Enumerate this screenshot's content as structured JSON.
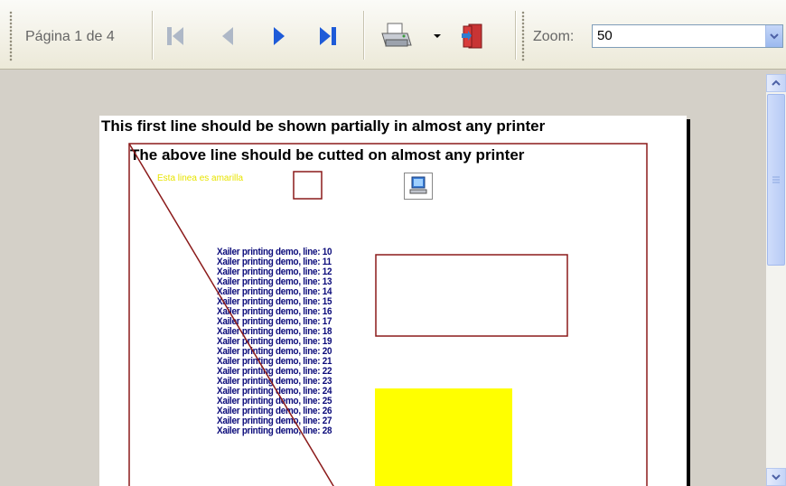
{
  "toolbar": {
    "page_label": "Página 1 de 4",
    "zoom_label": "Zoom:",
    "zoom_value": "50",
    "buttons": [
      "first-page",
      "previous-page",
      "next-page",
      "last-page",
      "print",
      "print-options",
      "exit"
    ]
  },
  "document": {
    "line1": "This first line should be shown partially in almost any printer",
    "line2": "The above line should be cutted on almost any printer",
    "yellow_text": "Esta linea es amarilla",
    "demo_lines": [
      "Xailer printing demo, line: 10",
      "Xailer printing demo, line: 11",
      "Xailer printing demo, line: 12",
      "Xailer printing demo, line: 13",
      "Xailer printing demo, line: 14",
      "Xailer printing demo, line: 15",
      "Xailer printing demo, line: 16",
      "Xailer printing demo, line: 17",
      "Xailer printing demo, line: 18",
      "Xailer printing demo, line: 19",
      "Xailer printing demo, line: 20",
      "Xailer printing demo, line: 21",
      "Xailer printing demo, line: 22",
      "Xailer printing demo, line: 23",
      "Xailer printing demo, line: 24",
      "Xailer printing demo, line: 25",
      "Xailer printing demo, line: 26",
      "Xailer printing demo, line: 27",
      "Xailer printing demo, line: 28"
    ]
  },
  "colors": {
    "frame": "#8b1a1a",
    "highlight": "#ffff00",
    "demo_text": "#0a0a7a",
    "nav_blue": "#1e5bd8"
  }
}
